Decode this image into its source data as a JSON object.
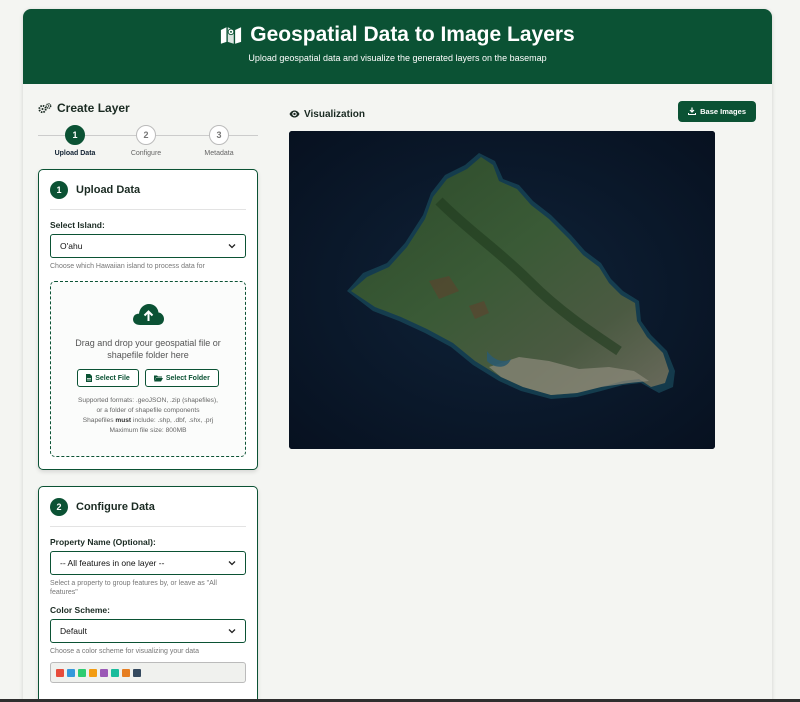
{
  "header": {
    "title": "Geospatial Data to Image Layers",
    "subtitle": "Upload geospatial data and visualize the generated layers on the basemap"
  },
  "left": {
    "title": "Create Layer",
    "steps": [
      {
        "num": "1",
        "label": "Upload Data"
      },
      {
        "num": "2",
        "label": "Configure"
      },
      {
        "num": "3",
        "label": "Metadata"
      }
    ],
    "upload": {
      "num": "1",
      "title": "Upload Data",
      "island_label": "Select Island:",
      "island_value": "O'ahu",
      "island_hint": "Choose which Hawaiian island to process data for",
      "drop_text": "Drag and drop your geospatial file or shapefile folder here",
      "select_file": "Select File",
      "select_folder": "Select Folder",
      "formats_line1": "Supported formats: .geoJSON, .zip (shapefiles),",
      "formats_line2": "or a folder of shapefile components",
      "shp_pre": "Shapefiles",
      "shp_bold": "must",
      "shp_post": "include: .shp, .dbf, .shx, .prj",
      "max_size": "Maximum file size: 800MB"
    },
    "configure": {
      "num": "2",
      "title": "Configure Data",
      "property_label": "Property Name (Optional):",
      "property_value": "-- All features in one layer --",
      "property_hint": "Select a property to group features by, or leave as \"All features\"",
      "color_label": "Color Scheme:",
      "color_value": "Default",
      "color_hint": "Choose a color scheme for visualizing your data",
      "swatches": [
        "#e74c3c",
        "#3498db",
        "#2ecc71",
        "#f39c12",
        "#9b59b6",
        "#1abc9c",
        "#e67e22",
        "#34495e"
      ]
    }
  },
  "visualization": {
    "title": "Visualization",
    "base_images_label": "Base Images"
  },
  "colors": {
    "brand": "#0b5234"
  }
}
